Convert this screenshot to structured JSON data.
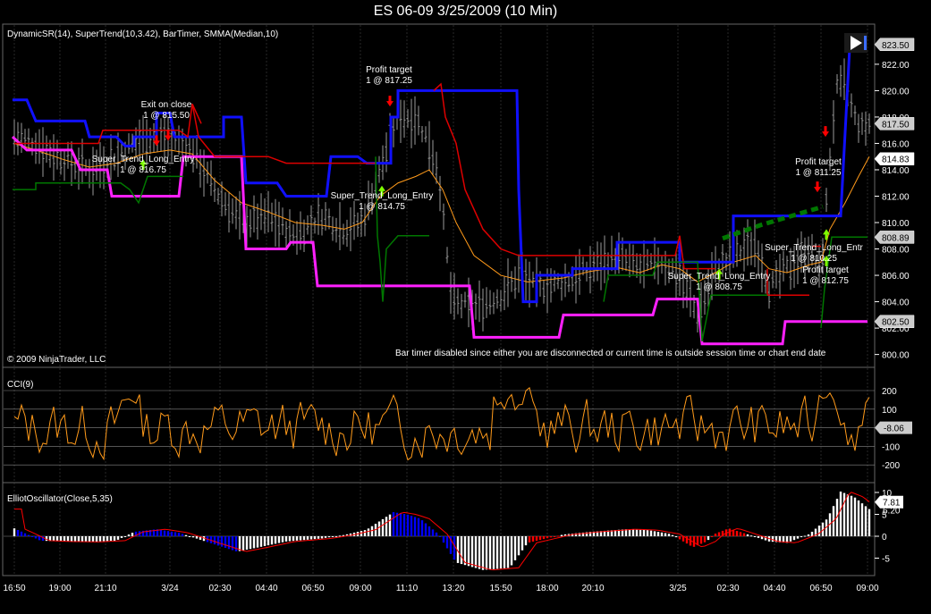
{
  "title": "ES 06-09  3/25/2009 (10 Min)",
  "colors": {
    "background": "#000000",
    "dynamic_sr_upper": "#1010ff",
    "dynamic_sr_lower": "#ff20ff",
    "supertrend_red": "#dd0000",
    "supertrend_green": "#007700",
    "smma": "#ff9a1a",
    "cci": "#ff9a1a",
    "elliot_positive_white": "#ffffff",
    "elliot_blue": "#0000ff",
    "elliot_red": "#ff0000",
    "entry_arrow": "#7fff00",
    "exit_arrow": "#ff0000"
  },
  "panels": {
    "price": {
      "indicator_label": "DynamicSR(14), SuperTrend(10,3.42), BarTimer, SMMA(Median,10)",
      "copyright": "© 2009 NinjaTrader, LLC",
      "bar_timer_message": "Bar timer disabled since either you are disconnected or current time is outside session time or chart end date",
      "y_ticks": [
        "800.00",
        "802.00",
        "804.00",
        "806.00",
        "808.00",
        "810.00",
        "812.00",
        "814.00",
        "816.00",
        "818.00",
        "820.00",
        "822.00"
      ],
      "price_markers": [
        {
          "value": "823.50",
          "style": "gray"
        },
        {
          "value": "817.50",
          "style": "gray"
        },
        {
          "value": "814.83",
          "style": "white"
        },
        {
          "value": "808.89",
          "style": "gray"
        },
        {
          "value": "802.50",
          "style": "gray"
        }
      ],
      "annotations": [
        {
          "text": "Exit on close",
          "sub": "1 @ 815.50"
        },
        {
          "text": "Super_Trend_Long_Entry",
          "sub": "1 @ 816.75"
        },
        {
          "text": "Profit target",
          "sub": "1 @ 817.25"
        },
        {
          "text": "Super_Trend_Long_Entry",
          "sub": "1 @ 814.75"
        },
        {
          "text": "Super_Trend_Long_Entry",
          "sub": "1 @ 808.75"
        },
        {
          "text": "Profit target",
          "sub": "1 @ 811.25"
        },
        {
          "text": "Super_Trend_Long_Entr",
          "sub": "1 @ 810.25"
        },
        {
          "text": "Profit target",
          "sub": "1 @ 812.75"
        }
      ]
    },
    "cci": {
      "label": "CCI(9)",
      "y_ticks": [
        "200",
        "100",
        "0",
        "-100",
        "-200"
      ],
      "current": "-8.06"
    },
    "elliot": {
      "label": "ElliotOscillator(Close,5,35)",
      "y_ticks": [
        "10",
        "5",
        "0",
        "-5"
      ],
      "marker_top": "7.81",
      "marker_under": "6.20"
    }
  },
  "x_axis": {
    "ticks": [
      "16:50",
      "19:00",
      "21:10",
      "3/24",
      "02:30",
      "04:40",
      "06:50",
      "09:00",
      "11:10",
      "13:20",
      "15:50",
      "18:00",
      "20:10",
      "3/25",
      "02:30",
      "04:40",
      "06:50",
      "09:00"
    ]
  },
  "chart_data": {
    "type": "line",
    "title": "ES 06-09  3/25/2009 (10 Min)",
    "x": [
      "16:50",
      "19:00",
      "21:10",
      "3/24",
      "02:30",
      "04:40",
      "06:50",
      "09:00",
      "11:10",
      "13:20",
      "15:50",
      "18:00",
      "20:10",
      "3/25",
      "02:30",
      "04:40",
      "06:50",
      "09:00"
    ],
    "ylim": [
      799.5,
      824.5
    ],
    "series": [
      {
        "name": "DynamicSR upper",
        "values": [
          819.2,
          816.5,
          816.5,
          815.5,
          816.0,
          812.5,
          812.0,
          814.5,
          820.0,
          820.0,
          804.0,
          806.0,
          806.0,
          806.0,
          810.5,
          810.5,
          810.5,
          823.0
        ]
      },
      {
        "name": "DynamicSR lower",
        "values": [
          815.5,
          814.0,
          812.0,
          815.0,
          808.0,
          808.0,
          805.0,
          805.0,
          805.0,
          805.0,
          801.3,
          801.3,
          802.0,
          802.0,
          800.8,
          800.8,
          802.5,
          802.5
        ]
      },
      {
        "name": "SuperTrend",
        "values": [
          816.0,
          816.0,
          816.0,
          816.0,
          814.0,
          814.0,
          814.0,
          814.0,
          820.0,
          814.0,
          808.0,
          807.5,
          807.5,
          807.5,
          804.0,
          804.0,
          807.5,
          808.9
        ]
      },
      {
        "name": "SMMA(Median,10)",
        "values": [
          816.0,
          815.0,
          814.5,
          815.0,
          812.0,
          810.0,
          809.5,
          810.0,
          814.0,
          810.0,
          806.0,
          805.5,
          806.5,
          806.0,
          807.0,
          806.0,
          808.0,
          814.8
        ]
      }
    ]
  }
}
